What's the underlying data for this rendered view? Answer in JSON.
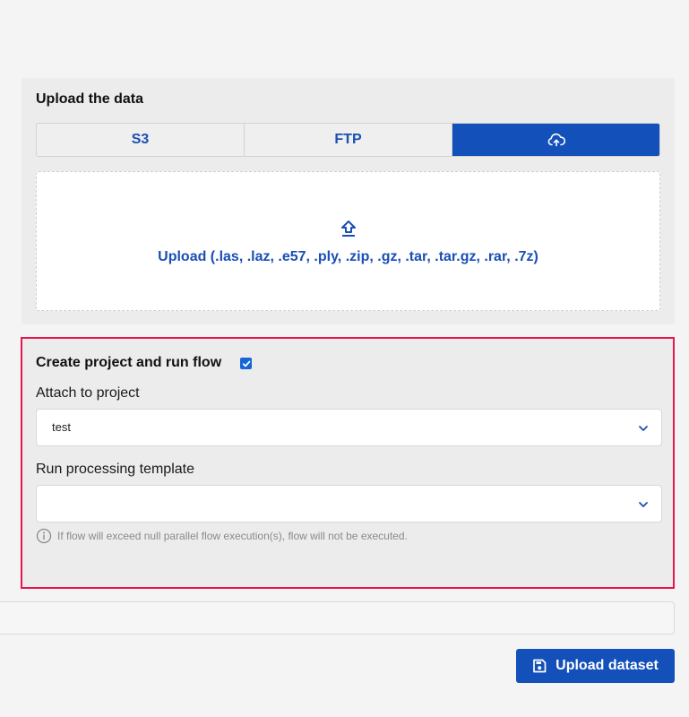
{
  "upload": {
    "title": "Upload the data",
    "tabs": [
      {
        "label": "S3",
        "active": false
      },
      {
        "label": "FTP",
        "active": false
      },
      {
        "label": "",
        "icon": "cloud-upload-icon",
        "active": true
      }
    ],
    "dropzone_text": "Upload (.las, .laz, .e57, .ply, .zip, .gz, .tar, .tar.gz, .rar, .7z)",
    "dropzone_icon": "upload-arrow-icon"
  },
  "project": {
    "title": "Create project and run flow",
    "checked": true,
    "attach_label": "Attach to project",
    "attach_value": "test",
    "template_label": "Run processing template",
    "template_value": "",
    "hint": "If flow will exceed null parallel flow execution(s), flow will not be executed."
  },
  "submit": {
    "label": "Upload dataset",
    "icon": "save-icon"
  },
  "colors": {
    "primary": "#1450b9",
    "highlight_border": "#e8164e"
  }
}
